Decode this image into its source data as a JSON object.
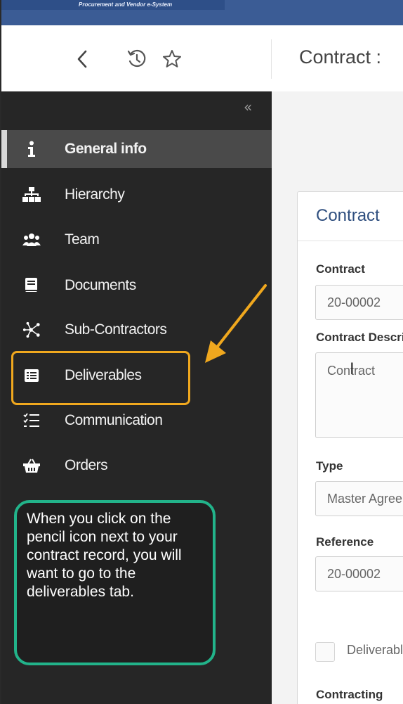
{
  "banner": {
    "system_name": "Procurement and Vendor e-System"
  },
  "toolbar": {
    "back_icon": "chevron-left-icon",
    "history_icon": "history-icon",
    "star_icon": "star-icon"
  },
  "page": {
    "title": "Contract :"
  },
  "sidebar": {
    "collapse_label": "«",
    "items": [
      {
        "label": "General info",
        "icon": "info-icon",
        "active": true
      },
      {
        "label": "Hierarchy",
        "icon": "sitemap-icon",
        "active": false
      },
      {
        "label": "Team",
        "icon": "users-icon",
        "active": false
      },
      {
        "label": "Documents",
        "icon": "book-icon",
        "active": false
      },
      {
        "label": "Sub-Contractors",
        "icon": "network-icon",
        "active": false
      },
      {
        "label": "Deliverables",
        "icon": "list-alt-icon",
        "active": false
      },
      {
        "label": "Communication",
        "icon": "tasks-icon",
        "active": false
      },
      {
        "label": "Orders",
        "icon": "basket-icon",
        "active": false
      }
    ]
  },
  "annotation": {
    "callout_text": "When you click on the pencil icon next to your contract record, you  will want to go to the deliverables tab.",
    "highlight_color": "#f0a81e",
    "callout_color": "#22b38a"
  },
  "panel": {
    "title": "Contract",
    "fields": {
      "contract_label": "Contract",
      "contract_value": "20-00002",
      "description_label": "Contract Description",
      "description_value": "Contract",
      "type_label": "Type",
      "type_value": "Master Agreement",
      "reference_label": "Reference",
      "reference_value": "20-00002",
      "deliverables_checkbox_label": "Deliverables",
      "contracting_label": "Contracting"
    }
  }
}
